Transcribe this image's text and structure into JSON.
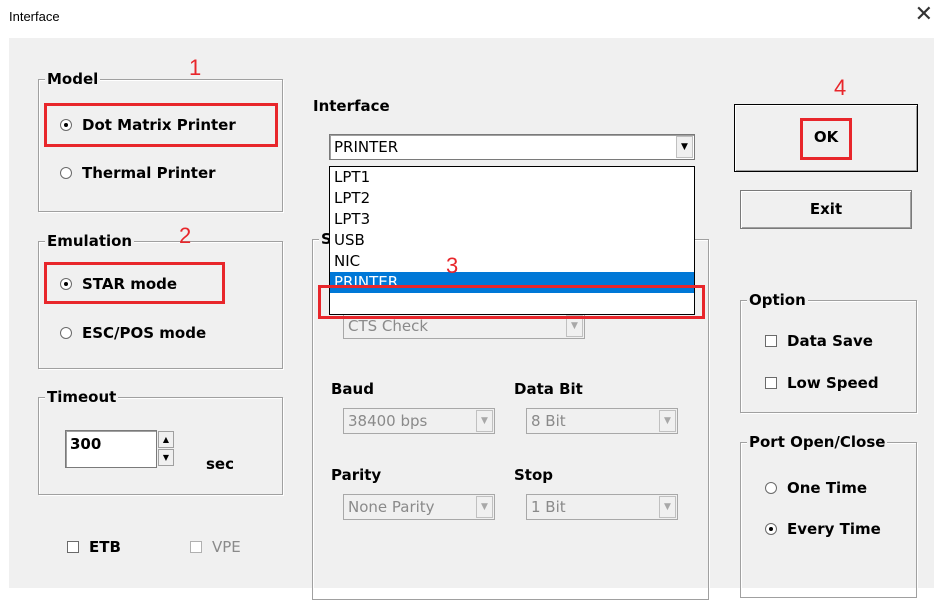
{
  "window": {
    "title": "Interface",
    "close_glyph": "✕"
  },
  "model": {
    "title": "Model",
    "options": [
      {
        "label": "Dot Matrix Printer",
        "selected": true
      },
      {
        "label": "Thermal Printer",
        "selected": false
      }
    ]
  },
  "emulation": {
    "title": "Emulation",
    "options": [
      {
        "label": "STAR mode",
        "selected": true
      },
      {
        "label": "ESC/POS mode",
        "selected": false
      }
    ]
  },
  "timeout": {
    "title": "Timeout",
    "value": "300",
    "unit": "sec"
  },
  "checks_bottom": [
    {
      "label": "ETB",
      "checked": false,
      "enabled": true
    },
    {
      "label": "VPE",
      "checked": false,
      "enabled": false
    }
  ],
  "interface": {
    "label": "Interface",
    "selected": "PRINTER",
    "options": [
      "LPT1",
      "LPT2",
      "LPT3",
      "USB",
      "NIC",
      "PRINTER"
    ]
  },
  "serial": {
    "title_visible": "S",
    "flow_value": "CTS Check",
    "baud_label": "Baud",
    "baud_value": "38400 bps",
    "databit_label": "Data Bit",
    "databit_value": "8 Bit",
    "parity_label": "Parity",
    "parity_value": "None Parity",
    "stop_label": "Stop",
    "stop_value": "1 Bit"
  },
  "buttons": {
    "ok": "OK",
    "exit": "Exit"
  },
  "option": {
    "title": "Option",
    "items": [
      {
        "label": "Data Save",
        "checked": false
      },
      {
        "label": "Low Speed",
        "checked": false
      }
    ]
  },
  "port": {
    "title": "Port Open/Close",
    "options": [
      {
        "label": "One Time",
        "selected": false
      },
      {
        "label": "Every Time",
        "selected": true
      }
    ]
  },
  "annotations": [
    "1",
    "2",
    "3",
    "4"
  ],
  "colors": {
    "highlight": "#e8262b",
    "selection": "#0078d7",
    "dialog_bg": "#f0f0f0"
  }
}
